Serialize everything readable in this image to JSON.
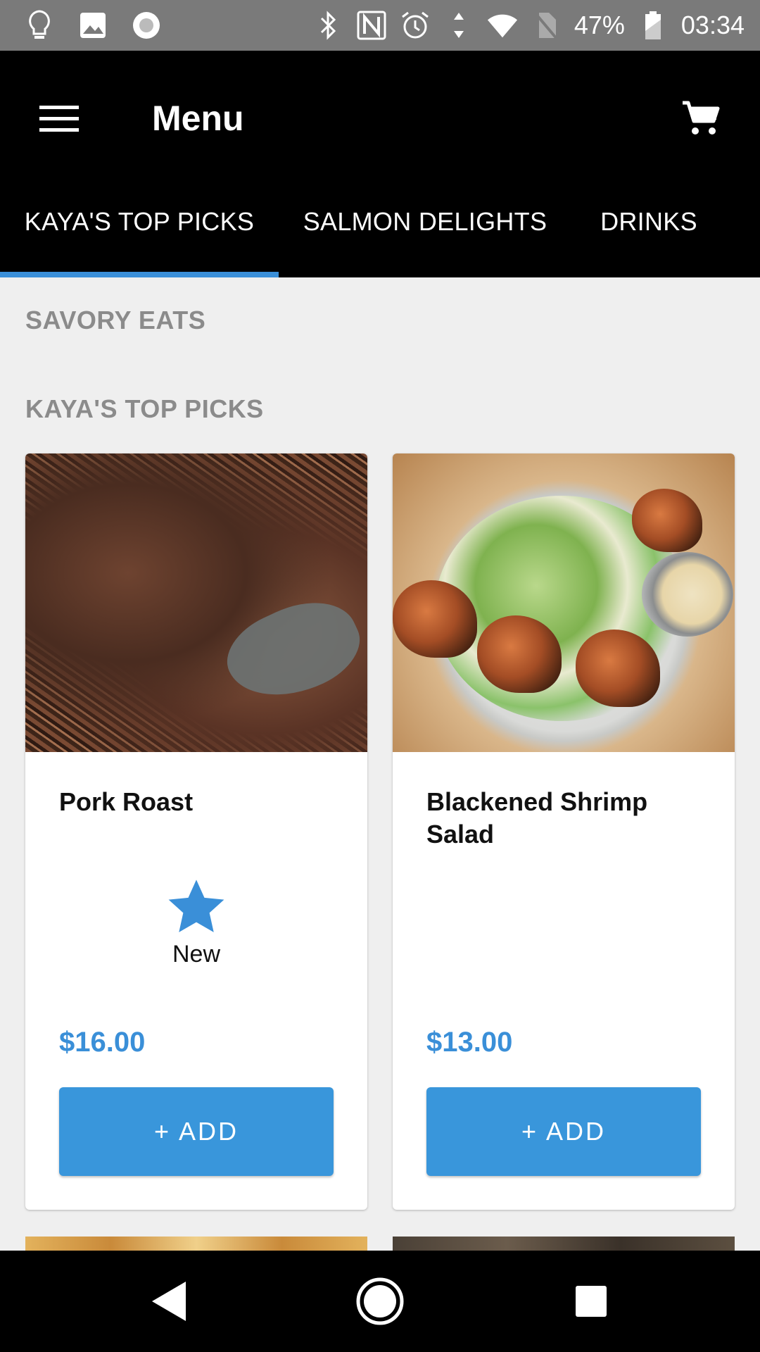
{
  "status_bar": {
    "battery": "47%",
    "time": "03:34",
    "left_icons": [
      "lightbulb-icon",
      "image-icon",
      "circle-icon"
    ],
    "right_icons": [
      "bluetooth-icon",
      "nfc-icon",
      "alarm-icon",
      "data-arrows-icon",
      "wifi-icon",
      "no-sim-icon",
      "battery-icon"
    ]
  },
  "app_bar": {
    "title": "Menu",
    "menu_icon": "hamburger-icon",
    "cart_icon": "cart-icon"
  },
  "tabs": [
    {
      "label": "KAYA'S TOP PICKS",
      "selected": true
    },
    {
      "label": "SALMON DELIGHTS",
      "selected": false
    },
    {
      "label": "DRINKS",
      "selected": false
    }
  ],
  "sections": {
    "category": "SAVORY EATS",
    "subcategory": "KAYA'S TOP PICKS"
  },
  "items": [
    {
      "name": "Pork Roast",
      "badge": "New",
      "badge_icon": "star-icon",
      "price": "$16.00",
      "button": "+ ADD"
    },
    {
      "name": "Blackened Shrimp Salad",
      "badge": "",
      "price": "$13.00",
      "button": "+ ADD"
    }
  ],
  "colors": {
    "accent": "#3a8fd8",
    "button": "#3996db",
    "app_bar": "#000000",
    "status_bar": "#7a7a7a",
    "background": "#efefef"
  },
  "nav_bar": {
    "icons": [
      "back-icon",
      "home-icon",
      "recents-icon"
    ]
  }
}
